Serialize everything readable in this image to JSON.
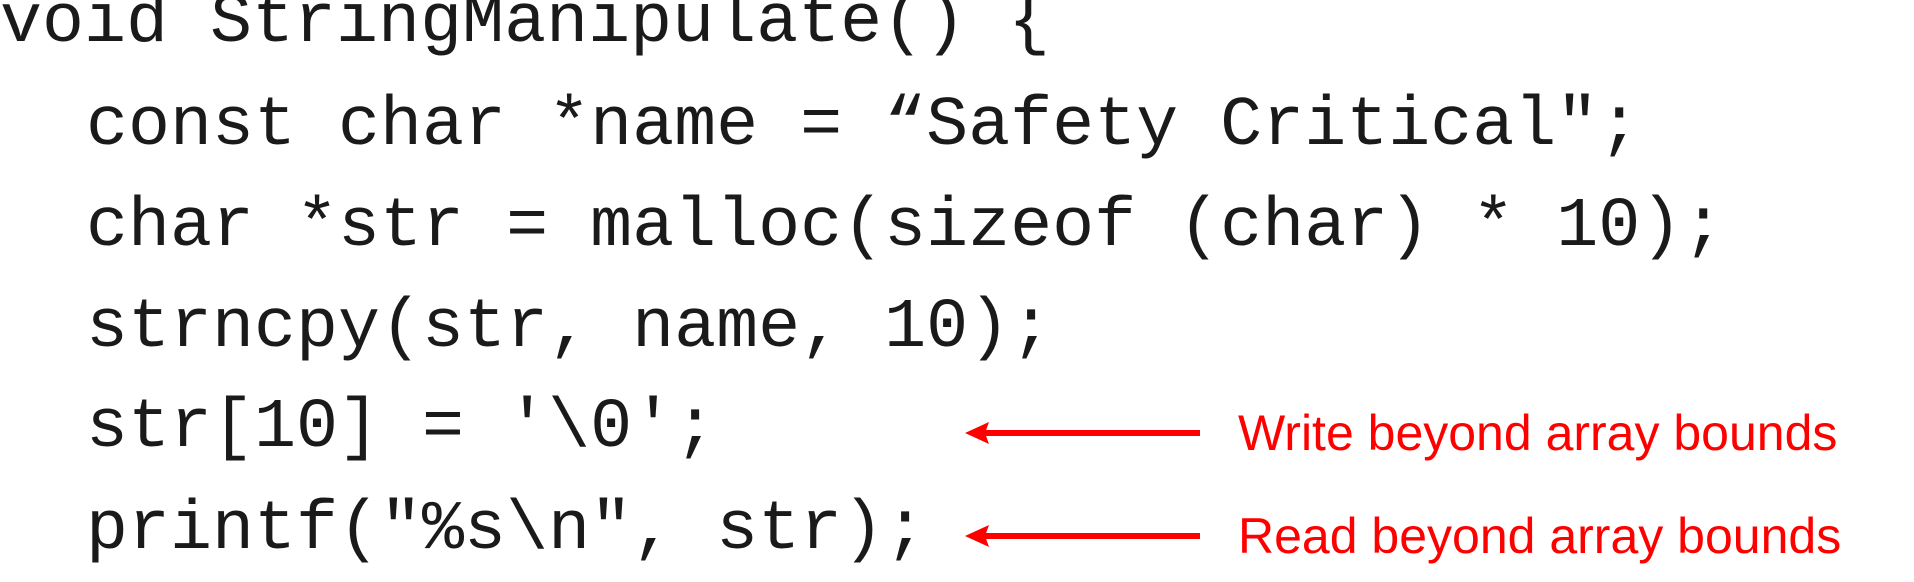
{
  "code": {
    "lines": [
      "void StringManipulate() {",
      "const char *name = “Safety Critical\";",
      "char *str = malloc(sizeof (char) * 10);",
      "strncpy(str, name, 10);",
      "str[10] = '\\0';",
      "printf(\"%s\\n\", str);"
    ]
  },
  "annotations": [
    {
      "label": "Write beyond array bounds",
      "points_to_line": 5
    },
    {
      "label": "Read beyond array bounds",
      "points_to_line": 6
    }
  ],
  "colors": {
    "code_text": "#1a1a1a",
    "annotation": "#ff0000",
    "background": "#ffffff"
  },
  "icons": {
    "arrow": "left-arrow-icon"
  }
}
